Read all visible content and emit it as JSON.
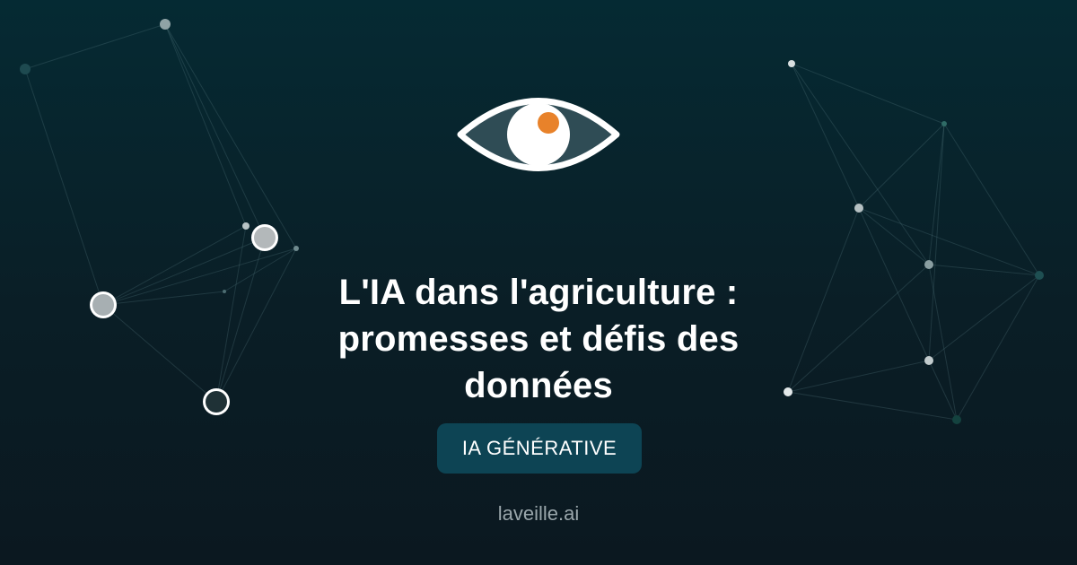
{
  "article": {
    "title": "L'IA dans l'agriculture : promesses et défis des données",
    "category": "IA GÉNÉRATIVE",
    "site": "laveille.ai"
  },
  "icons": {
    "logo": "eye-icon"
  },
  "colors": {
    "background_top": "#052a33",
    "background_bottom": "#0b1820",
    "badge_background": "#0d4454",
    "pupil_accent": "#e8822a",
    "text_primary": "#ffffff",
    "text_muted": "#9aa6ab"
  }
}
